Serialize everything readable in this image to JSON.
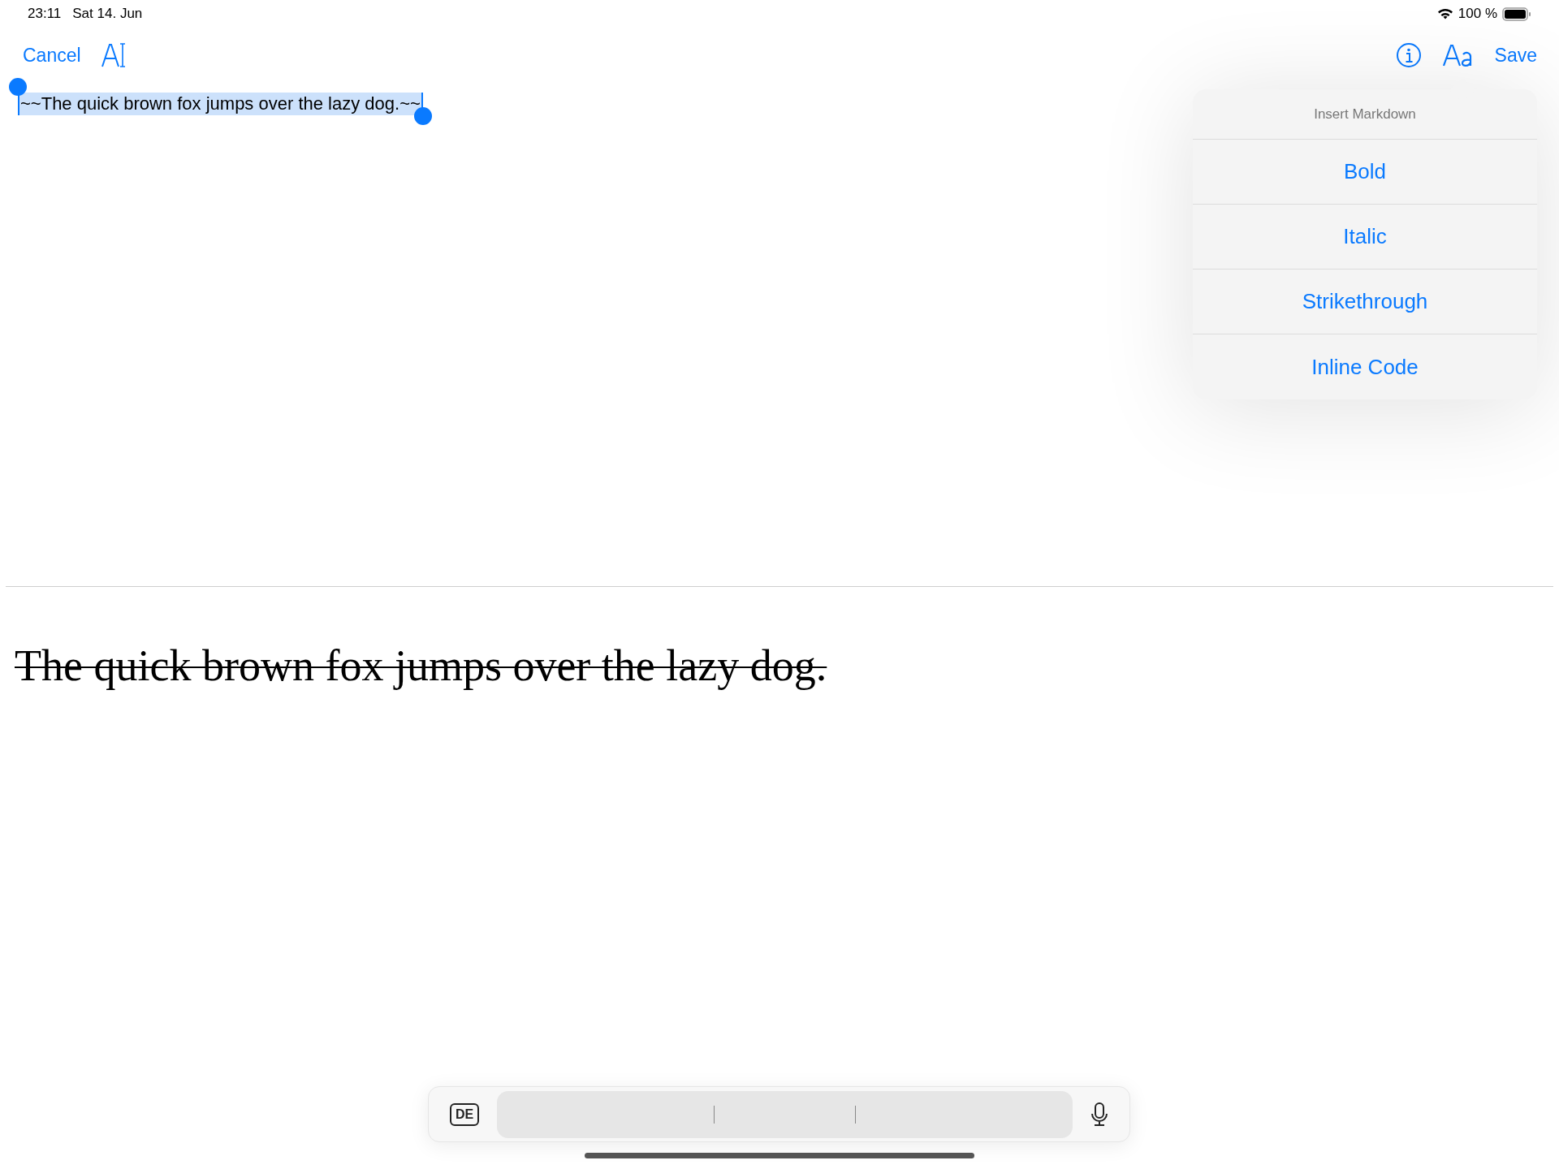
{
  "status_bar": {
    "time": "23:11",
    "date": "Sat 14. Jun",
    "battery": "100 %"
  },
  "toolbar": {
    "cancel": "Cancel",
    "save": "Save"
  },
  "editor": {
    "text": "~~The quick brown fox jumps over the lazy dog.~~",
    "selected": true
  },
  "preview": {
    "text": "The quick brown fox jumps over the lazy dog.",
    "strikethrough": true
  },
  "popover": {
    "title": "Insert Markdown",
    "items": [
      {
        "label": "Bold"
      },
      {
        "label": "Italic"
      },
      {
        "label": "Strikethrough"
      },
      {
        "label": "Inline Code"
      }
    ]
  },
  "shortcut_bar": {
    "language": "DE"
  }
}
